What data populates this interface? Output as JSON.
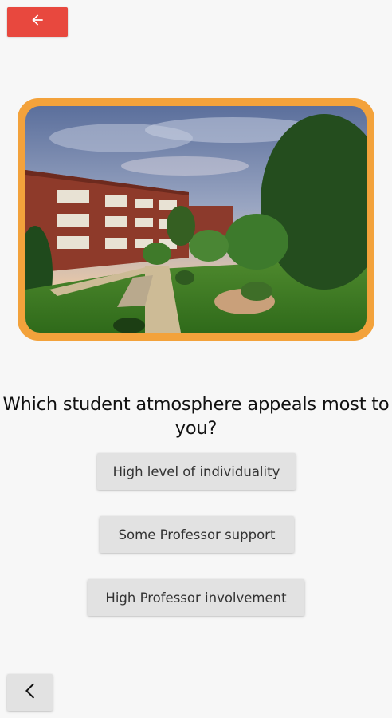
{
  "header": {
    "back_icon": "arrow-left-icon",
    "back_button_color": "#e8483e"
  },
  "image": {
    "frame_color": "#f3a23b"
  },
  "question": {
    "text": "Which student atmosphere appeals most to you?"
  },
  "options": [
    {
      "label": "High level of individuality"
    },
    {
      "label": "Some Professor support"
    },
    {
      "label": "High Professor involvement"
    }
  ],
  "footer": {
    "back_icon": "chevron-left-icon"
  }
}
